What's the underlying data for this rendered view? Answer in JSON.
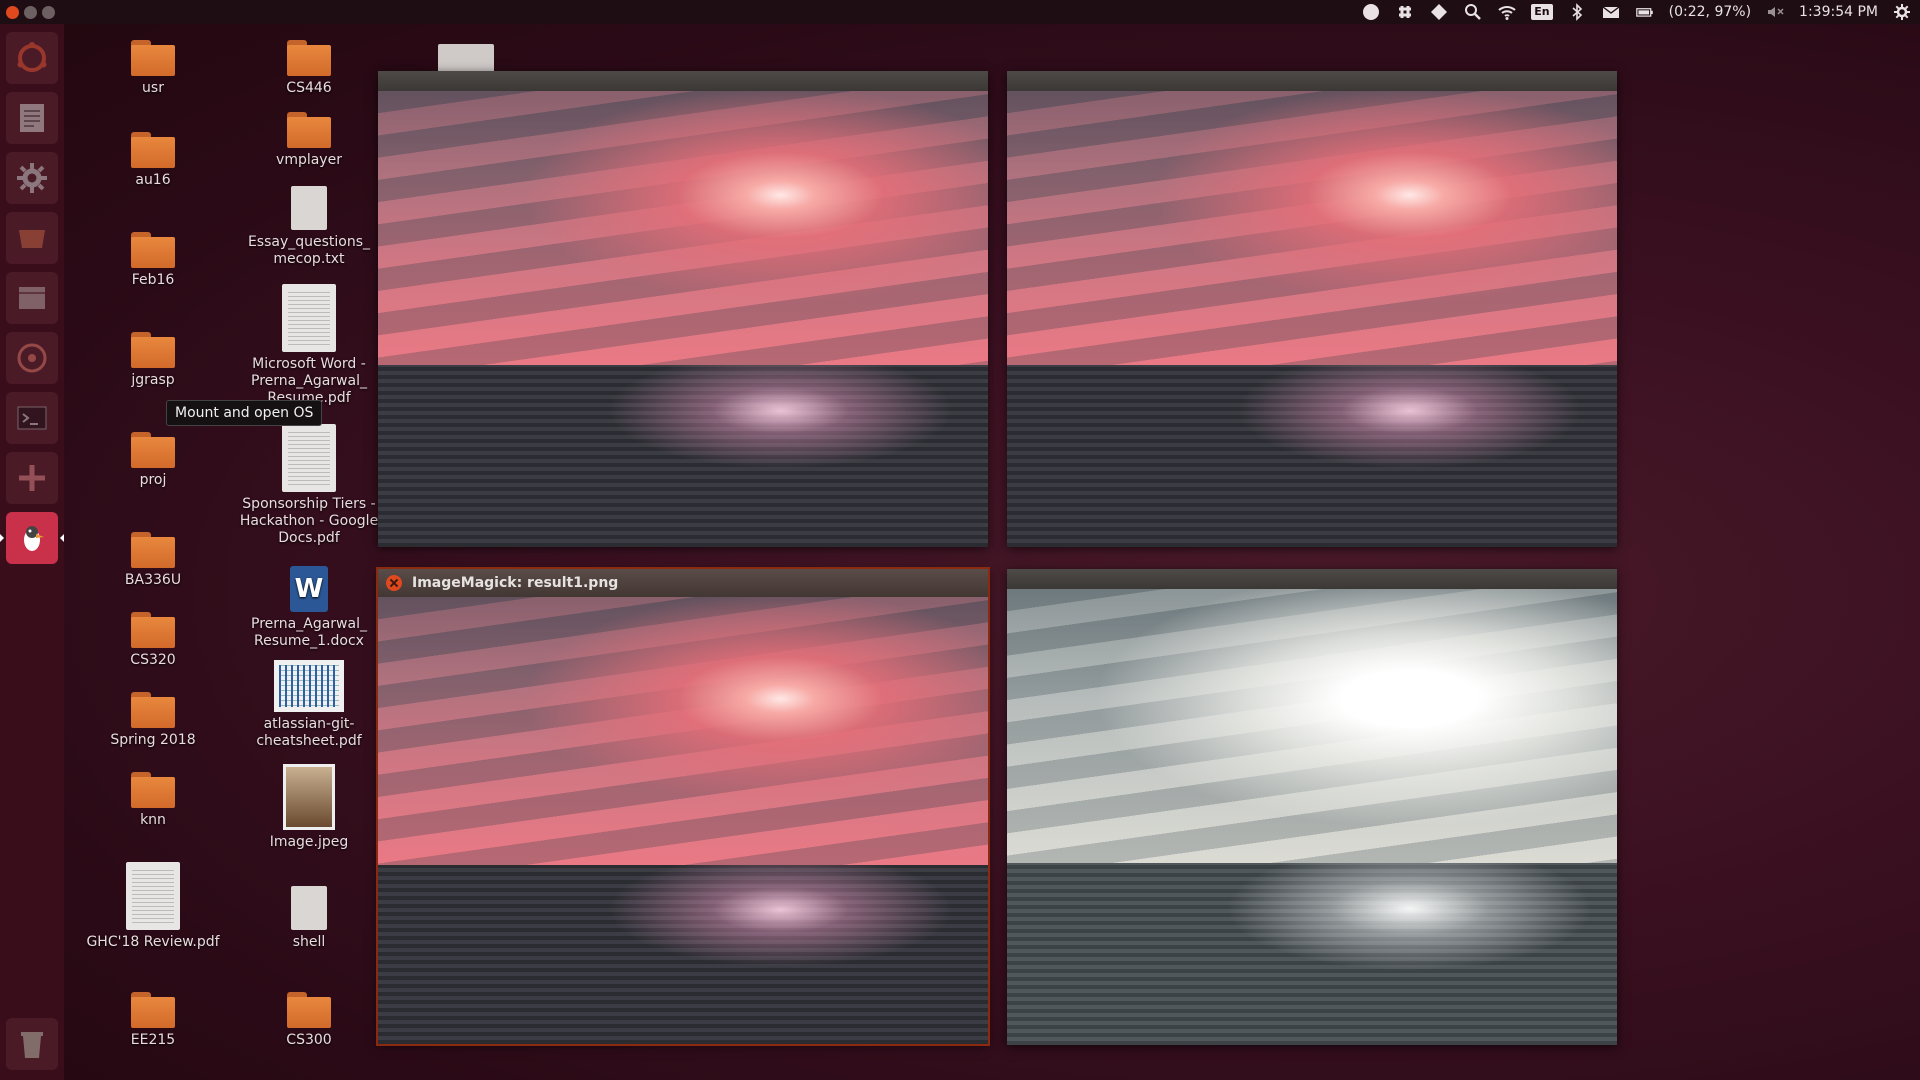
{
  "top_panel": {
    "battery_text": "(0:22, 97%)",
    "keyboard_layout": "En",
    "clock": "1:39:54 PM"
  },
  "launcher": {
    "items": [
      "ubuntu-dash-icon",
      "text-editor-icon",
      "settings-icon",
      "files-icon",
      "file-manager-icon",
      "disc-icon",
      "terminal-icon",
      "tweak-icon",
      "gimp-icon"
    ],
    "trash": "trash-icon"
  },
  "desktop": {
    "col1": [
      "usr",
      "au16",
      "Feb16",
      "jgrasp",
      "proj",
      "BA336U",
      "CS320",
      "Spring 2018",
      "knn",
      "GHC'18 Review.pdf",
      "EE215"
    ],
    "col2": [
      "CS446",
      "vmplayer",
      "Essay_questions_\nmecop.txt",
      "Microsoft Word -\nPrerna_Agarwal_\nResume.pdf",
      "Sponsorship Tiers -\nHackathon - Google\nDocs.pdf",
      "Prerna_Agarwal_\nResume_1.docx",
      "atlassian-git-\ncheatsheet.pdf",
      "Image.jpeg",
      "shell",
      "CS300"
    ]
  },
  "tooltip": "Mount and open OS",
  "windows": {
    "focused_title": "ImageMagick: result1.png"
  },
  "colors": {
    "accent": "#e0481e",
    "launcher_bg": "#3a0d1b",
    "panel_bg": "#1f0d14"
  }
}
